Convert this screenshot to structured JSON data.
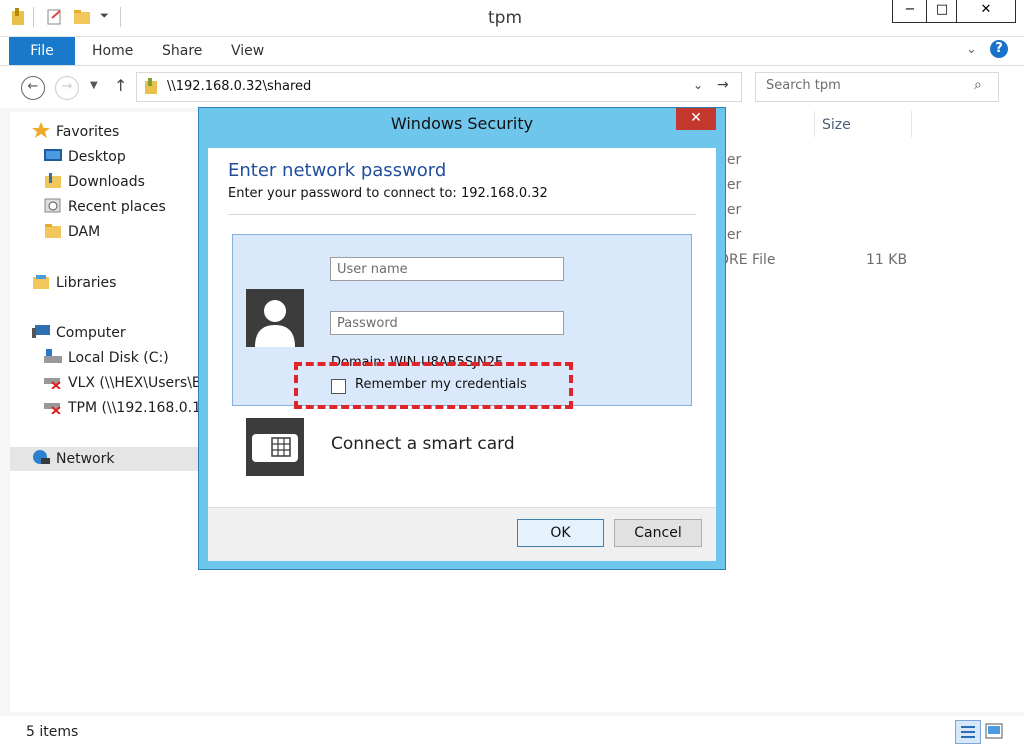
{
  "window": {
    "title": "tpm",
    "minimize": "−",
    "maximize": "□",
    "close": "✕"
  },
  "ribbon": {
    "tabs": [
      "File",
      "Home",
      "Share",
      "View"
    ],
    "help": "?"
  },
  "address": {
    "path": "\\\\192.168.0.32\\shared"
  },
  "search": {
    "placeholder": "Search tpm"
  },
  "nav": {
    "favorites": "Favorites",
    "items_fav": [
      "Desktop",
      "Downloads",
      "Recent places",
      "DAM"
    ],
    "libraries": "Libraries",
    "computer": "Computer",
    "items_comp": [
      "Local Disk (C:)",
      "VLX (\\\\HEX\\Users\\Bl",
      "TPM (\\\\192.168.0.18)"
    ],
    "network": "Network"
  },
  "filelist": {
    "size_header": "Size",
    "rows": [
      {
        "type": "der",
        "size": ""
      },
      {
        "type": "der",
        "size": ""
      },
      {
        "type": "der",
        "size": ""
      },
      {
        "type": "der",
        "size": ""
      },
      {
        "type": "ORE File",
        "size": "11 KB"
      }
    ]
  },
  "status": {
    "items": "5 items"
  },
  "dialog": {
    "title": "Windows Security",
    "close": "✕",
    "heading": "Enter network password",
    "subheading": "Enter your password to connect to: 192.168.0.32",
    "username_placeholder": "User name",
    "password_placeholder": "Password",
    "domain": "Domain: WIN-U8AB5SJN2F",
    "remember": "Remember my credentials",
    "smartcard": "Connect a smart card",
    "ok": "OK",
    "cancel": "Cancel",
    "accent": "#6fc6ec",
    "highlight_color": "#e0252a"
  }
}
